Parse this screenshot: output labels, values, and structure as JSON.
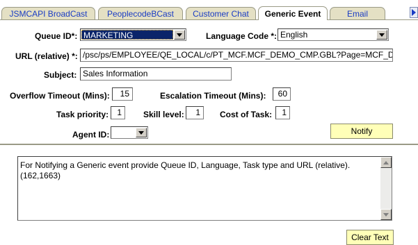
{
  "tabs": [
    {
      "label": "JSMCAPI BroadCast"
    },
    {
      "label": "PeoplecodeBCast"
    },
    {
      "label": "Customer Chat"
    },
    {
      "label": "Generic Event"
    },
    {
      "label": "Email"
    }
  ],
  "active_tab": "Generic Event",
  "form": {
    "queue_id_label": "Queue ID*:",
    "queue_id_value": "MARKETING",
    "language_code_label": "Language Code *:",
    "language_code_value": "English",
    "url_label": "URL (relative) *:",
    "url_value": "/psc/ps/EMPLOYEE/QE_LOCAL/c/PT_MCF.MCF_DEMO_CMP.GBL?Page=MCF_D",
    "subject_label": "Subject:",
    "subject_value": "Sales Information",
    "overflow_timeout_label": "Overflow Timeout (Mins):",
    "overflow_timeout_value": "15",
    "escalation_timeout_label": "Escalation Timeout (Mins):",
    "escalation_timeout_value": "60",
    "task_priority_label": "Task priority:",
    "task_priority_value": "1",
    "skill_level_label": "Skill level:",
    "skill_level_value": "1",
    "cost_of_task_label": "Cost of Task:",
    "cost_of_task_value": "1",
    "agent_id_label": "Agent ID:",
    "agent_id_value": ""
  },
  "buttons": {
    "notify": "Notify",
    "clear_text": "Clear Text"
  },
  "output": {
    "text": "For Notifying a Generic event provide Queue ID, Language, Task type and URL (relative).\n(162,1663)"
  },
  "colors": {
    "tab_inactive_bg": "#e4e0c4",
    "tab_text": "#1a3cc4",
    "button_bg": "#ffffb8",
    "selection_bg": "#0a246a"
  },
  "icons": {
    "tab_scroll": "triangle-right-icon",
    "dropdown": "chevron-down-icon",
    "scroll_up": "triangle-up-icon",
    "scroll_down": "triangle-down-icon"
  }
}
